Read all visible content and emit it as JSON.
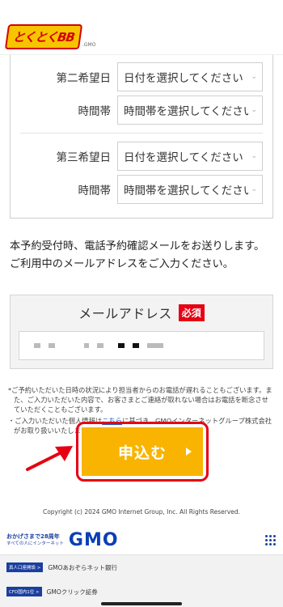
{
  "header": {
    "logo_text": "とくとくBB",
    "logo_sub": ".GMO"
  },
  "schedule": {
    "second": {
      "date_label": "第二希望日",
      "date_value": "日付を選択してください",
      "time_label": "時間帯",
      "time_value": "時間帯を選択してください"
    },
    "third": {
      "date_label": "第三希望日",
      "date_value": "日付を選択してください",
      "time_label": "時間帯",
      "time_value": "時間帯を選択してください"
    }
  },
  "notice": {
    "line1": "本予約受付時、電話予約確認メールをお送りします。",
    "line2": "ご利用中のメールアドレスをご入力ください。"
  },
  "email": {
    "label": "メールアドレス",
    "required": "必須"
  },
  "fineprint": {
    "item1": "*ご予約いただいた日時の状況により担当者からのお電話が遅れることもございます。また、ご入力いただいた内容で、お客さまとご連絡が取れない場合はお電話を断念させていただくこともございます。",
    "item2_pre": "・ご入力いただいた個人情報は",
    "item2_link": "こちら",
    "item2_post": "に基づき、GMOインターネットグループ株式会社がお取り扱いいたします。"
  },
  "submit": {
    "label": "申込む"
  },
  "copyright": "Copyright (c) 2024 GMO Internet Group, Inc. All Rights Reserved.",
  "footer": {
    "tag_line1": "おかげさまで28周年",
    "tag_line2": "すべての人にインターネット",
    "gmo_logo": "GMO",
    "services": [
      {
        "badge": "真人口座開設 >",
        "name": "GMOあおぞらネット銀行"
      },
      {
        "badge": "CFD国内1位 >",
        "name": "GMOクリック証券"
      }
    ]
  },
  "colors": {
    "accent": "#f8b400",
    "required": "#e60012",
    "gmo_blue": "#0a3fb5"
  }
}
